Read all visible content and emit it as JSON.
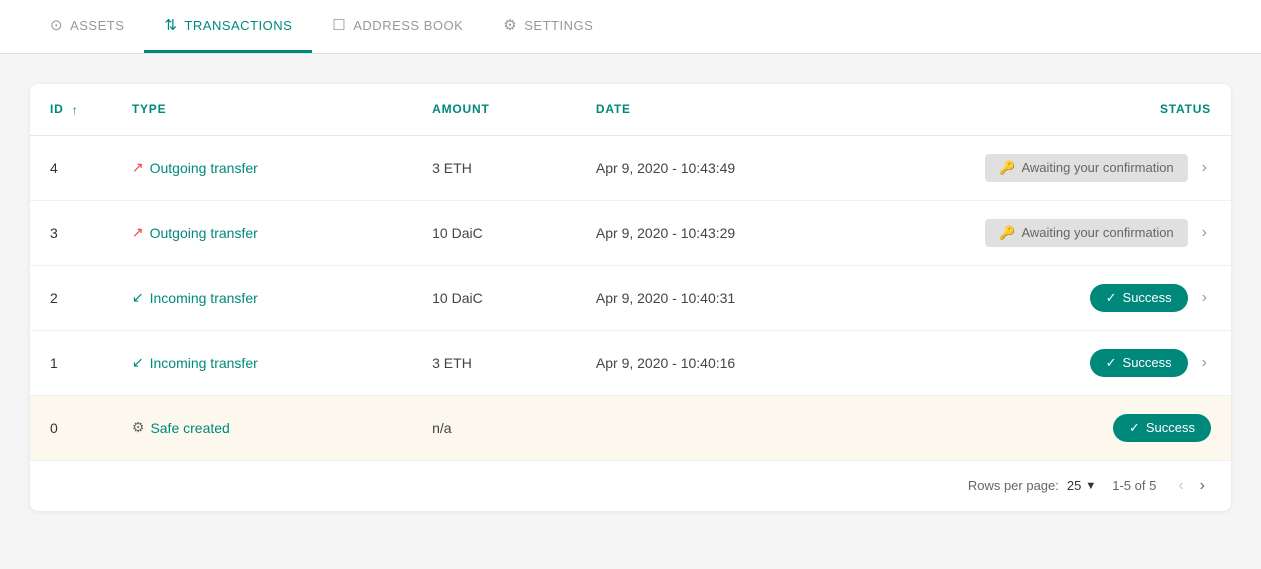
{
  "nav": {
    "tabs": [
      {
        "id": "assets",
        "label": "ASSETS",
        "icon": "⊙",
        "active": false
      },
      {
        "id": "transactions",
        "label": "TRANSACTIONS",
        "icon": "⇅",
        "active": true
      },
      {
        "id": "address-book",
        "label": "ADDRESS BOOK",
        "icon": "☐",
        "active": false
      },
      {
        "id": "settings",
        "label": "SETTINGS",
        "icon": "⚙",
        "active": false
      }
    ]
  },
  "table": {
    "columns": [
      {
        "id": "id",
        "label": "ID",
        "sortable": true
      },
      {
        "id": "type",
        "label": "TYPE",
        "sortable": false
      },
      {
        "id": "amount",
        "label": "AMOUNT",
        "sortable": false
      },
      {
        "id": "date",
        "label": "DATE",
        "sortable": false
      },
      {
        "id": "status",
        "label": "STATUS",
        "sortable": false,
        "align": "right"
      }
    ],
    "rows": [
      {
        "id": "4",
        "type": "Outgoing transfer",
        "type_direction": "outgoing",
        "amount": "3 ETH",
        "date": "Apr 9, 2020 - 10:43:49",
        "status": "awaiting",
        "status_label": "Awaiting your confirmation",
        "highlighted": false
      },
      {
        "id": "3",
        "type": "Outgoing transfer",
        "type_direction": "outgoing",
        "amount": "10 DaiC",
        "date": "Apr 9, 2020 - 10:43:29",
        "status": "awaiting",
        "status_label": "Awaiting your confirmation",
        "highlighted": false
      },
      {
        "id": "2",
        "type": "Incoming transfer",
        "type_direction": "incoming",
        "amount": "10 DaiC",
        "date": "Apr 9, 2020 - 10:40:31",
        "status": "success",
        "status_label": "Success",
        "highlighted": false
      },
      {
        "id": "1",
        "type": "Incoming transfer",
        "type_direction": "incoming",
        "amount": "3 ETH",
        "date": "Apr 9, 2020 - 10:40:16",
        "status": "success",
        "status_label": "Success",
        "highlighted": false
      },
      {
        "id": "0",
        "type": "Safe created",
        "type_direction": "safe",
        "amount": "n/a",
        "date": "",
        "status": "success",
        "status_label": "Success",
        "highlighted": true
      }
    ]
  },
  "pagination": {
    "rows_per_page_label": "Rows per page:",
    "rows_per_page_value": "25",
    "page_info": "1-5 of 5"
  }
}
